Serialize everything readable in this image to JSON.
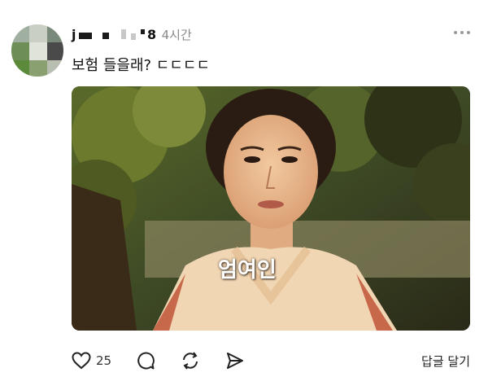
{
  "post": {
    "username_visible_start": "j",
    "username_visible_end": "8",
    "timestamp": "4시간",
    "text": "보험 들을래? ㄷㄷㄷㄷ",
    "media": {
      "caption": "엄여인"
    },
    "actions": {
      "like_count": "25",
      "reply_label": "답글 달기"
    }
  },
  "icons": {
    "like": "heart-icon",
    "comment": "comment-icon",
    "repost": "repost-icon",
    "share": "share-icon",
    "more": "more-horizontal-icon"
  }
}
